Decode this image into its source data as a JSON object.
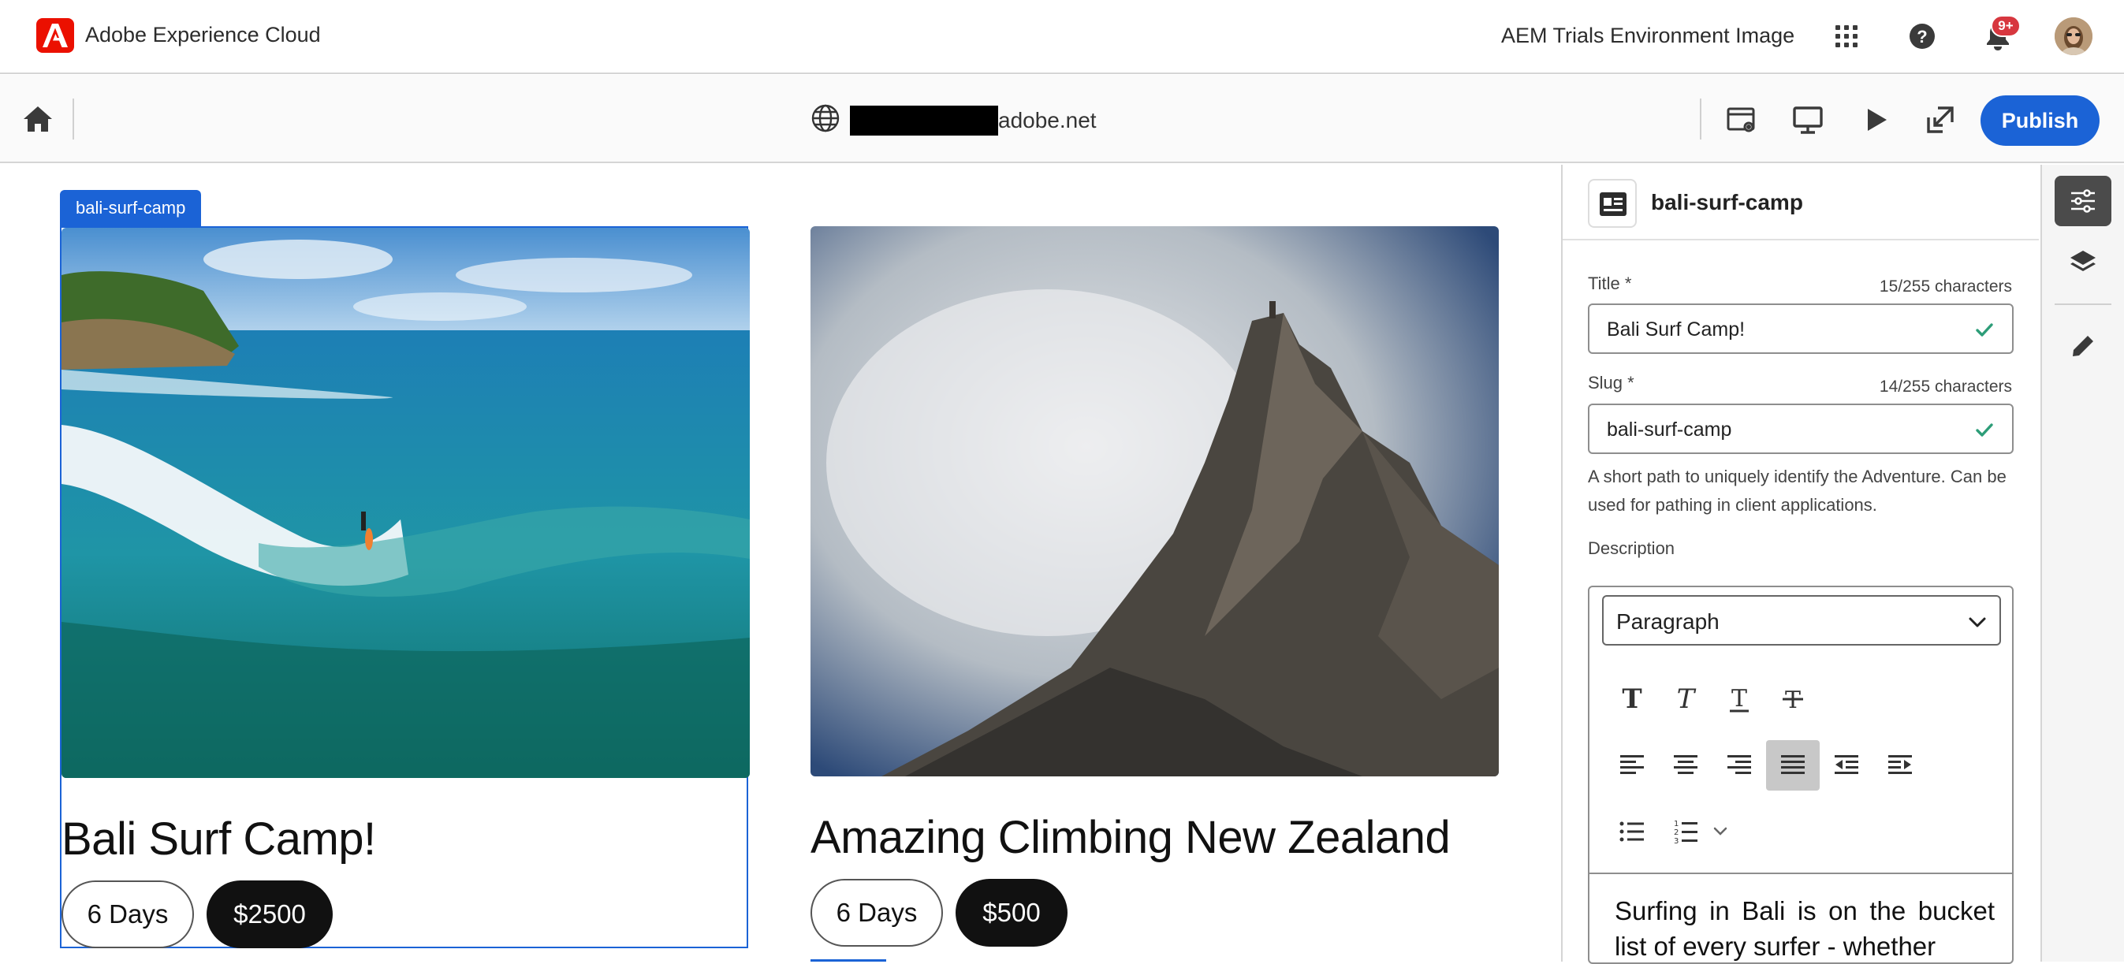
{
  "header": {
    "brand": "Adobe Experience Cloud",
    "environment": "AEM Trials Environment Image",
    "notifications_badge": "9+",
    "icons": [
      "adobe-logo-icon",
      "apps-grid-icon",
      "help-icon",
      "bell-icon",
      "user-avatar"
    ]
  },
  "toolbar": {
    "url_suffix": "adobe.net",
    "publish_label": "Publish",
    "icons": [
      "home-icon",
      "globe-icon",
      "page-properties-icon",
      "desktop-preview-icon",
      "play-preview-icon",
      "open-external-icon"
    ]
  },
  "canvas": {
    "selection_label": "bali-surf-camp",
    "cards": [
      {
        "title": "Bali Surf Camp!",
        "duration": "6 Days",
        "price": "$2500"
      },
      {
        "title": "Amazing Climbing New Zealand",
        "duration": "6 Days",
        "price": "$500"
      }
    ]
  },
  "panel": {
    "component_name": "bali-surf-camp",
    "title_field": {
      "label": "Title",
      "required": "*",
      "count": "15/255 characters",
      "value": "Bali Surf Camp!"
    },
    "slug_field": {
      "label": "Slug",
      "required": "*",
      "count": "14/255 characters",
      "value": "bali-surf-camp"
    },
    "slug_help": "A short path to uniquely identify the Adventure. Can be used for pathing in client applications.",
    "description_label": "Description",
    "paragraph_format": "Paragraph",
    "description_text": "Surfing in Bali is on the bucket list of every surfer - whether"
  },
  "colors": {
    "accent": "#1b63d6",
    "adobe_red": "#eb1000",
    "badge_red": "#d7373f",
    "valid_green": "#2d9d78"
  }
}
